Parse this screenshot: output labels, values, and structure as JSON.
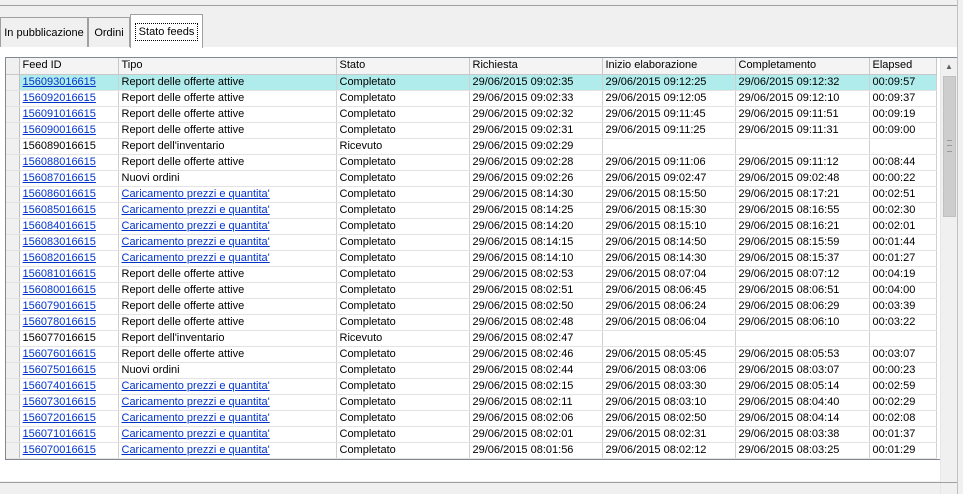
{
  "tabs": [
    {
      "label": "In pubblicazione",
      "active": false
    },
    {
      "label": "Ordini",
      "active": false
    },
    {
      "label": "Stato feeds",
      "active": true
    }
  ],
  "grid": {
    "columns": [
      "Feed ID",
      "Tipo",
      "Stato",
      "Richiesta",
      "Inizio elaborazione",
      "Completamento",
      "Elapsed"
    ],
    "selected_row_index": 0,
    "rows": [
      {
        "id": "156093016615",
        "tipo": "Report delle offerte attive",
        "tipo_link": false,
        "stato": "Completato",
        "richiesta": "29/06/2015 09:02:35",
        "inizio": "29/06/2015 09:12:25",
        "completamento": "29/06/2015 09:12:32",
        "elapsed": "00:09:57"
      },
      {
        "id": "156092016615",
        "tipo": "Report delle offerte attive",
        "tipo_link": false,
        "stato": "Completato",
        "richiesta": "29/06/2015 09:02:33",
        "inizio": "29/06/2015 09:12:05",
        "completamento": "29/06/2015 09:12:10",
        "elapsed": "00:09:37"
      },
      {
        "id": "156091016615",
        "tipo": "Report delle offerte attive",
        "tipo_link": false,
        "stato": "Completato",
        "richiesta": "29/06/2015 09:02:32",
        "inizio": "29/06/2015 09:11:45",
        "completamento": "29/06/2015 09:11:51",
        "elapsed": "00:09:19"
      },
      {
        "id": "156090016615",
        "tipo": "Report delle offerte attive",
        "tipo_link": false,
        "stato": "Completato",
        "richiesta": "29/06/2015 09:02:31",
        "inizio": "29/06/2015 09:11:25",
        "completamento": "29/06/2015 09:11:31",
        "elapsed": "00:09:00"
      },
      {
        "id": "156089016615",
        "tipo": "Report dell'inventario",
        "tipo_link": false,
        "stato": "Ricevuto",
        "richiesta": "29/06/2015 09:02:29",
        "inizio": "",
        "completamento": "",
        "elapsed": "",
        "id_link": false
      },
      {
        "id": "156088016615",
        "tipo": "Report delle offerte attive",
        "tipo_link": false,
        "stato": "Completato",
        "richiesta": "29/06/2015 09:02:28",
        "inizio": "29/06/2015 09:11:06",
        "completamento": "29/06/2015 09:11:12",
        "elapsed": "00:08:44"
      },
      {
        "id": "156087016615",
        "tipo": "Nuovi ordini",
        "tipo_link": false,
        "stato": "Completato",
        "richiesta": "29/06/2015 09:02:26",
        "inizio": "29/06/2015 09:02:47",
        "completamento": "29/06/2015 09:02:48",
        "elapsed": "00:00:22"
      },
      {
        "id": "156086016615",
        "tipo": "Caricamento prezzi e quantita'",
        "tipo_link": true,
        "stato": "Completato",
        "richiesta": "29/06/2015 08:14:30",
        "inizio": "29/06/2015 08:15:50",
        "completamento": "29/06/2015 08:17:21",
        "elapsed": "00:02:51"
      },
      {
        "id": "156085016615",
        "tipo": "Caricamento prezzi e quantita'",
        "tipo_link": true,
        "stato": "Completato",
        "richiesta": "29/06/2015 08:14:25",
        "inizio": "29/06/2015 08:15:30",
        "completamento": "29/06/2015 08:16:55",
        "elapsed": "00:02:30"
      },
      {
        "id": "156084016615",
        "tipo": "Caricamento prezzi e quantita'",
        "tipo_link": true,
        "stato": "Completato",
        "richiesta": "29/06/2015 08:14:20",
        "inizio": "29/06/2015 08:15:10",
        "completamento": "29/06/2015 08:16:21",
        "elapsed": "00:02:01"
      },
      {
        "id": "156083016615",
        "tipo": "Caricamento prezzi e quantita'",
        "tipo_link": true,
        "stato": "Completato",
        "richiesta": "29/06/2015 08:14:15",
        "inizio": "29/06/2015 08:14:50",
        "completamento": "29/06/2015 08:15:59",
        "elapsed": "00:01:44"
      },
      {
        "id": "156082016615",
        "tipo": "Caricamento prezzi e quantita'",
        "tipo_link": true,
        "stato": "Completato",
        "richiesta": "29/06/2015 08:14:10",
        "inizio": "29/06/2015 08:14:30",
        "completamento": "29/06/2015 08:15:37",
        "elapsed": "00:01:27"
      },
      {
        "id": "156081016615",
        "tipo": "Report delle offerte attive",
        "tipo_link": false,
        "stato": "Completato",
        "richiesta": "29/06/2015 08:02:53",
        "inizio": "29/06/2015 08:07:04",
        "completamento": "29/06/2015 08:07:12",
        "elapsed": "00:04:19"
      },
      {
        "id": "156080016615",
        "tipo": "Report delle offerte attive",
        "tipo_link": false,
        "stato": "Completato",
        "richiesta": "29/06/2015 08:02:51",
        "inizio": "29/06/2015 08:06:45",
        "completamento": "29/06/2015 08:06:51",
        "elapsed": "00:04:00"
      },
      {
        "id": "156079016615",
        "tipo": "Report delle offerte attive",
        "tipo_link": false,
        "stato": "Completato",
        "richiesta": "29/06/2015 08:02:50",
        "inizio": "29/06/2015 08:06:24",
        "completamento": "29/06/2015 08:06:29",
        "elapsed": "00:03:39"
      },
      {
        "id": "156078016615",
        "tipo": "Report delle offerte attive",
        "tipo_link": false,
        "stato": "Completato",
        "richiesta": "29/06/2015 08:02:48",
        "inizio": "29/06/2015 08:06:04",
        "completamento": "29/06/2015 08:06:10",
        "elapsed": "00:03:22"
      },
      {
        "id": "156077016615",
        "tipo": "Report dell'inventario",
        "tipo_link": false,
        "stato": "Ricevuto",
        "richiesta": "29/06/2015 08:02:47",
        "inizio": "",
        "completamento": "",
        "elapsed": "",
        "id_link": false
      },
      {
        "id": "156076016615",
        "tipo": "Report delle offerte attive",
        "tipo_link": false,
        "stato": "Completato",
        "richiesta": "29/06/2015 08:02:46",
        "inizio": "29/06/2015 08:05:45",
        "completamento": "29/06/2015 08:05:53",
        "elapsed": "00:03:07"
      },
      {
        "id": "156075016615",
        "tipo": "Nuovi ordini",
        "tipo_link": false,
        "stato": "Completato",
        "richiesta": "29/06/2015 08:02:44",
        "inizio": "29/06/2015 08:03:06",
        "completamento": "29/06/2015 08:03:07",
        "elapsed": "00:00:23"
      },
      {
        "id": "156074016615",
        "tipo": "Caricamento prezzi e quantita'",
        "tipo_link": true,
        "stato": "Completato",
        "richiesta": "29/06/2015 08:02:15",
        "inizio": "29/06/2015 08:03:30",
        "completamento": "29/06/2015 08:05:14",
        "elapsed": "00:02:59"
      },
      {
        "id": "156073016615",
        "tipo": "Caricamento prezzi e quantita'",
        "tipo_link": true,
        "stato": "Completato",
        "richiesta": "29/06/2015 08:02:11",
        "inizio": "29/06/2015 08:03:10",
        "completamento": "29/06/2015 08:04:40",
        "elapsed": "00:02:29"
      },
      {
        "id": "156072016615",
        "tipo": "Caricamento prezzi e quantita'",
        "tipo_link": true,
        "stato": "Completato",
        "richiesta": "29/06/2015 08:02:06",
        "inizio": "29/06/2015 08:02:50",
        "completamento": "29/06/2015 08:04:14",
        "elapsed": "00:02:08"
      },
      {
        "id": "156071016615",
        "tipo": "Caricamento prezzi e quantita'",
        "tipo_link": true,
        "stato": "Completato",
        "richiesta": "29/06/2015 08:02:01",
        "inizio": "29/06/2015 08:02:31",
        "completamento": "29/06/2015 08:03:38",
        "elapsed": "00:01:37"
      },
      {
        "id": "156070016615",
        "tipo": "Caricamento prezzi e quantita'",
        "tipo_link": true,
        "stato": "Completato",
        "richiesta": "29/06/2015 08:01:56",
        "inizio": "29/06/2015 08:02:12",
        "completamento": "29/06/2015 08:03:25",
        "elapsed": "00:01:29"
      }
    ]
  },
  "scrollbar": {
    "up_icon": "arrow-up-icon",
    "down_icon": "arrow-down-icon"
  },
  "colors": {
    "selected_row": "#b0ecec",
    "link": "#0033cc"
  }
}
